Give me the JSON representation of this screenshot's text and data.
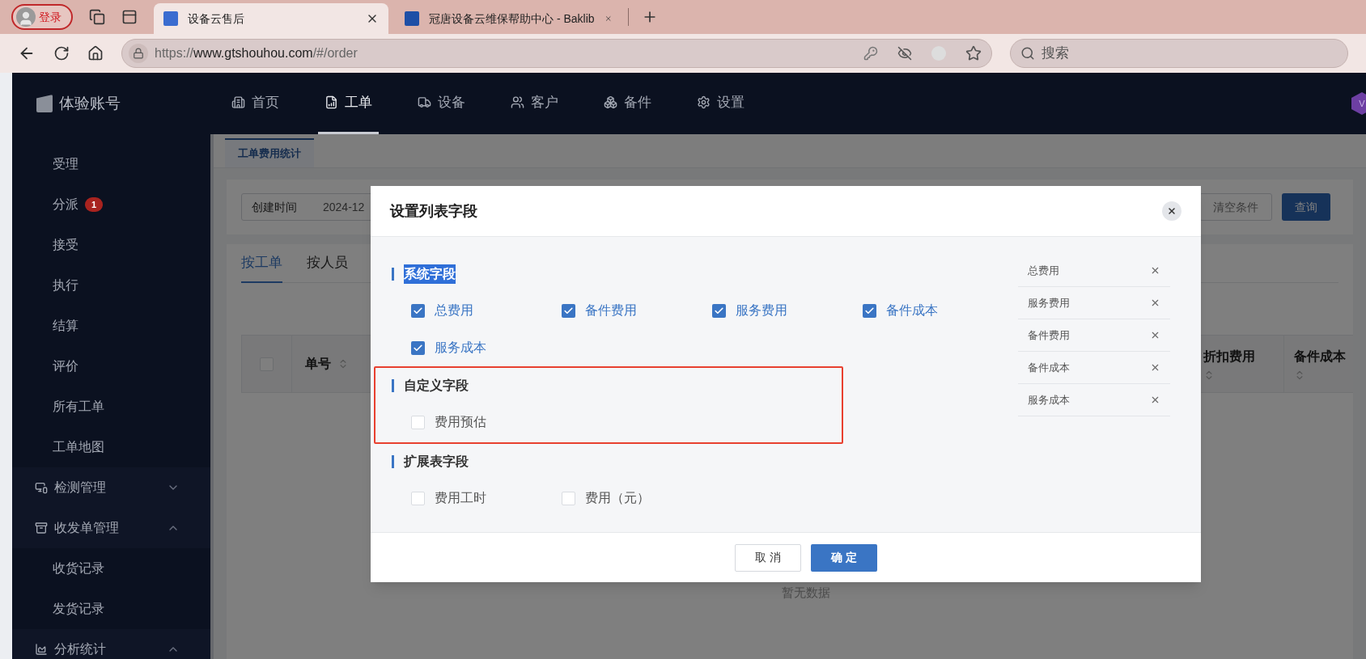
{
  "browser": {
    "profile": "登录",
    "tabs": [
      {
        "title": "设备云售后",
        "selected": true
      },
      {
        "title": "冠唐设备云维保帮助中心 - Baklib",
        "selected": false
      }
    ],
    "url_scheme": "https://",
    "url_host": "www.gtshouhou.com",
    "url_path": "/#/order",
    "search_placeholder": "搜索"
  },
  "app": {
    "account": "体验账号",
    "avatar": "V",
    "nav": [
      {
        "label": "首页",
        "selected": false
      },
      {
        "label": "工单",
        "selected": true
      },
      {
        "label": "设备",
        "selected": false
      },
      {
        "label": "客户",
        "selected": false
      },
      {
        "label": "备件",
        "selected": false
      },
      {
        "label": "设置",
        "selected": false
      }
    ],
    "sidebar": [
      {
        "kind": "item",
        "label": "受理"
      },
      {
        "kind": "item",
        "label": "分派",
        "badge": "1"
      },
      {
        "kind": "item",
        "label": "接受"
      },
      {
        "kind": "item",
        "label": "执行"
      },
      {
        "kind": "item",
        "label": "结算"
      },
      {
        "kind": "item",
        "label": "评价"
      },
      {
        "kind": "item",
        "label": "所有工单"
      },
      {
        "kind": "item",
        "label": "工单地图"
      },
      {
        "kind": "group",
        "label": "检测管理",
        "expanded": false
      },
      {
        "kind": "group",
        "label": "收发单管理",
        "expanded": true,
        "children": [
          {
            "kind": "item",
            "label": "收货记录"
          },
          {
            "kind": "item",
            "label": "发货记录"
          }
        ]
      },
      {
        "kind": "group",
        "label": "分析统计",
        "expanded": true
      }
    ]
  },
  "page": {
    "tab": "工单费用统计",
    "filter_label": "创建时间",
    "filter_value": "2024-12",
    "clear": "清空条件",
    "query": "查询",
    "subtabs": [
      {
        "label": "按工单",
        "selected": true
      },
      {
        "label": "按人员",
        "selected": false
      }
    ],
    "select_all_checked": false,
    "columns": [
      "单号",
      "折扣费用",
      "备件成本"
    ],
    "empty": "暂无数据"
  },
  "dialog": {
    "title": "设置列表字段",
    "sections": [
      {
        "title": "系统字段",
        "highlighted": true,
        "annotated": false,
        "options": [
          {
            "label": "总费用",
            "checked": true
          },
          {
            "label": "备件费用",
            "checked": true
          },
          {
            "label": "服务费用",
            "checked": true
          },
          {
            "label": "备件成本",
            "checked": true
          },
          {
            "label": "服务成本",
            "checked": true
          }
        ]
      },
      {
        "title": "自定义字段",
        "highlighted": false,
        "annotated": true,
        "options": [
          {
            "label": "费用预估",
            "checked": false
          }
        ]
      },
      {
        "title": "扩展表字段",
        "highlighted": false,
        "annotated": false,
        "options": [
          {
            "label": "费用工时",
            "checked": false
          },
          {
            "label": "费用（元）",
            "checked": false
          }
        ]
      }
    ],
    "selected_fields": [
      "总费用",
      "服务费用",
      "备件费用",
      "备件成本",
      "服务成本"
    ],
    "cancel": "取 消",
    "confirm": "确 定"
  }
}
